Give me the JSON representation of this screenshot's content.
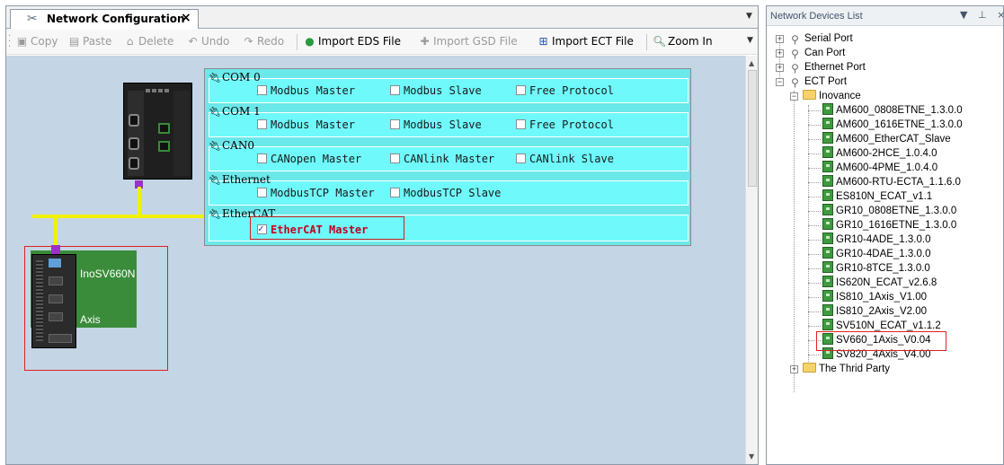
{
  "document_tab": {
    "title": "Network Configuration",
    "close_glyph": "×"
  },
  "toolbar": {
    "copy": "Copy",
    "paste": "Paste",
    "delete": "Delete",
    "undo": "Undo",
    "redo": "Redo",
    "import_eds": "Import EDS File",
    "import_gsd": "Import GSD File",
    "import_ect": "Import ECT File",
    "zoom_in": "Zoom In"
  },
  "config": {
    "groups": [
      {
        "label": "COM 0",
        "options": [
          {
            "label": "Modbus Master",
            "checked": false
          },
          {
            "label": "Modbus Slave",
            "checked": false
          },
          {
            "label": "Free Protocol",
            "checked": false
          }
        ]
      },
      {
        "label": "COM 1",
        "options": [
          {
            "label": "Modbus Master",
            "checked": false
          },
          {
            "label": "Modbus Slave",
            "checked": false
          },
          {
            "label": "Free Protocol",
            "checked": false
          }
        ]
      },
      {
        "label": "CAN0",
        "options": [
          {
            "label": "CANopen Master",
            "checked": false
          },
          {
            "label": "CANlink Master",
            "checked": false
          },
          {
            "label": "CANlink Slave",
            "checked": false
          }
        ]
      },
      {
        "label": "Ethernet",
        "options": [
          {
            "label": "ModbusTCP Master",
            "checked": false
          },
          {
            "label": "ModbusTCP Slave",
            "checked": false
          }
        ]
      },
      {
        "label": "EtherCAT",
        "options": [
          {
            "label": "EtherCAT Master",
            "checked": true
          }
        ]
      }
    ]
  },
  "drive": {
    "name": "InoSV660N",
    "role": "Axis"
  },
  "devices_panel": {
    "title": "Network Devices List",
    "pin_glyph": "⊥",
    "close_glyph": "×",
    "roots": [
      {
        "label": "Serial Port",
        "expanded": false
      },
      {
        "label": "Can Port",
        "expanded": false
      },
      {
        "label": "Ethernet Port",
        "expanded": false
      },
      {
        "label": "ECT Port",
        "expanded": true
      }
    ],
    "vendors": [
      {
        "label": "Inovance",
        "expanded": true
      },
      {
        "label": "The Thrid Party",
        "expanded": false
      }
    ],
    "devices": [
      "AM600_0808ETNE_1.3.0.0",
      "AM600_1616ETNE_1.3.0.0",
      "AM600_EtherCAT_Slave",
      "AM600-2HCE_1.0.4.0",
      "AM600-4PME_1.0.4.0",
      "AM600-RTU-ECTA_1.1.6.0",
      "ES810N_ECAT_v1.1",
      "GR10_0808ETNE_1.3.0.0",
      "GR10_1616ETNE_1.3.0.0",
      "GR10-4ADE_1.3.0.0",
      "GR10-4DAE_1.3.0.0",
      "GR10-8TCE_1.3.0.0",
      "IS620N_ECAT_v2.6.8",
      "IS810_1Axis_V1.00",
      "IS810_2Axis_V2.00",
      "SV510N_ECAT_v1.1.2",
      "SV660_1Axis_V0.04",
      "SV820_4Axis_V4.00"
    ],
    "selected_device": "SV660_1Axis_V0.04"
  }
}
